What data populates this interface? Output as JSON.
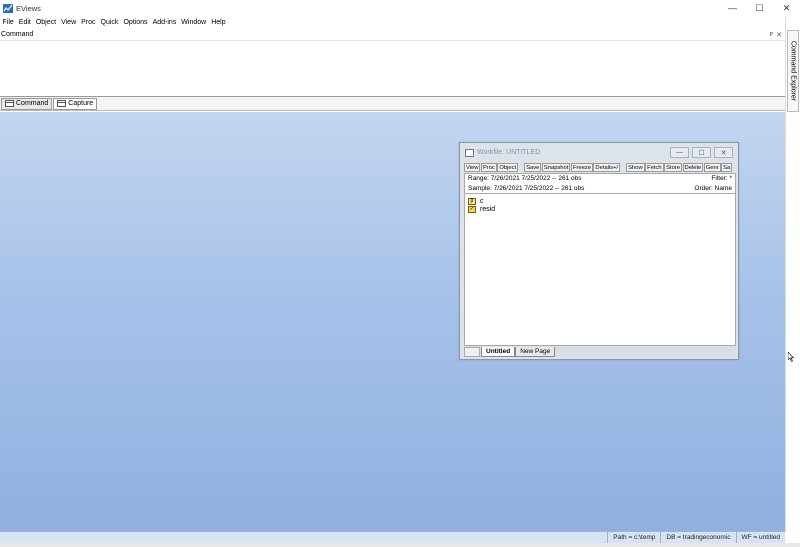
{
  "app": {
    "title": "EViews",
    "window_controls": [
      "—",
      "☐",
      "✕"
    ]
  },
  "menu": [
    "File",
    "Edit",
    "Object",
    "View",
    "Proc",
    "Quick",
    "Options",
    "Add-ins",
    "Window",
    "Help"
  ],
  "command_pane": {
    "header": "Command",
    "pin": "ᴘ",
    "close": "✕",
    "tabs": [
      {
        "label": "Command",
        "active": false
      },
      {
        "label": "Capture",
        "active": true
      }
    ]
  },
  "right_rail": {
    "label": "Command Explorer"
  },
  "workfile": {
    "title": "Workfile: UNTITLED",
    "controls": [
      "—",
      "☐",
      "✕"
    ],
    "toolbar": [
      "View",
      "Proc",
      "Object",
      "Save",
      "Snapshot",
      "Freeze",
      "Details+/",
      "Show",
      "Fetch",
      "Store",
      "Delete",
      "Genr",
      "Sa"
    ],
    "range": "Range:  7/26/2021 7/25/2022  --  261 obs",
    "filter": "Filter: *",
    "sample": "Sample: 7/26/2021 7/25/2022  --  261 obs",
    "order": "Order: Name",
    "objects": [
      {
        "name": "c",
        "icon": "coef-icon",
        "glyph": "β"
      },
      {
        "name": "resid",
        "icon": "resid-icon",
        "glyph": "✓"
      }
    ],
    "page_tabs": [
      {
        "label": "Untitled",
        "active": true
      },
      {
        "label": "New Page",
        "active": false
      }
    ]
  },
  "status": {
    "path": "Path = c:\\temp",
    "db": "DB = tradingeconomic",
    "wf": "WF = untitled"
  },
  "colors": {
    "mdi_top": "#c3d6ef",
    "mdi_bottom": "#8fb0e0",
    "status_bg": "#d4e4f5"
  }
}
